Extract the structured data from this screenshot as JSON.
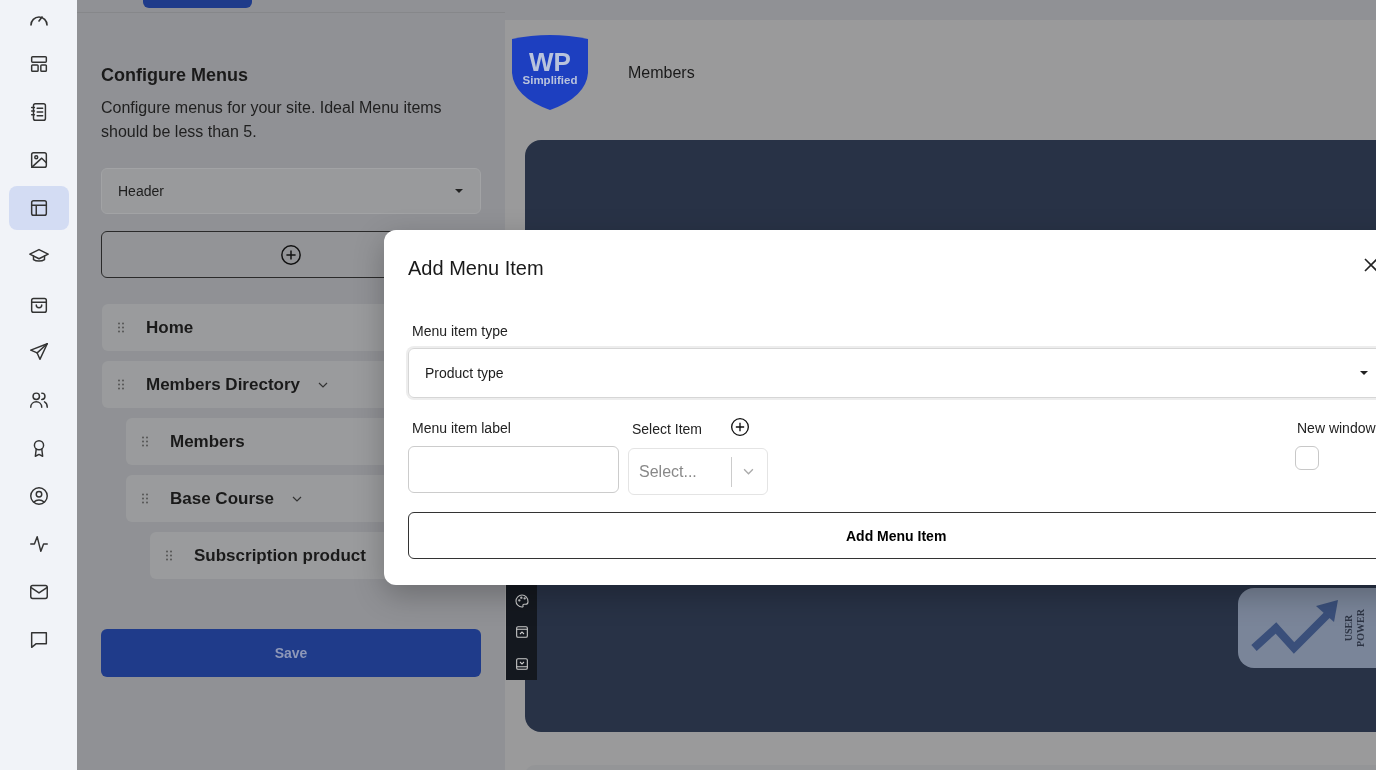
{
  "sidebar": {
    "items": [
      {
        "selected": false
      },
      {
        "selected": false
      },
      {
        "selected": false
      },
      {
        "selected": false
      },
      {
        "selected": true
      },
      {
        "selected": false
      },
      {
        "selected": false
      },
      {
        "selected": false
      },
      {
        "selected": false
      },
      {
        "selected": false
      },
      {
        "selected": false
      },
      {
        "selected": false
      },
      {
        "selected": false
      },
      {
        "selected": false
      }
    ]
  },
  "menus_panel": {
    "title": "Configure Menus",
    "description": "Configure menus for your site. Ideal Menu items should be less than 5.",
    "menu_select": {
      "value": "Header"
    },
    "menu_items": [
      {
        "label": "Home"
      },
      {
        "label": "Members Directory",
        "children": [
          {
            "label": "Members"
          },
          {
            "label": "Base Course",
            "children": [
              {
                "label": "Subscription product"
              }
            ]
          }
        ]
      }
    ],
    "save_button": "Save"
  },
  "preview": {
    "logo": {
      "line_1": "WP",
      "line_2": "Simplified"
    },
    "nav_item": "Members",
    "badge": {
      "line_1": "USER",
      "line_2": "POWER"
    }
  },
  "dialog": {
    "title": "Add Menu Item",
    "type_field": {
      "label": "Menu item type",
      "value": "Product type"
    },
    "label_field": {
      "label": "Menu item label"
    },
    "item_select": {
      "label": "Select Item",
      "placeholder": "Select..."
    },
    "new_window": {
      "label": "New window",
      "checked": false
    },
    "submit_button": "Add Menu Item"
  }
}
